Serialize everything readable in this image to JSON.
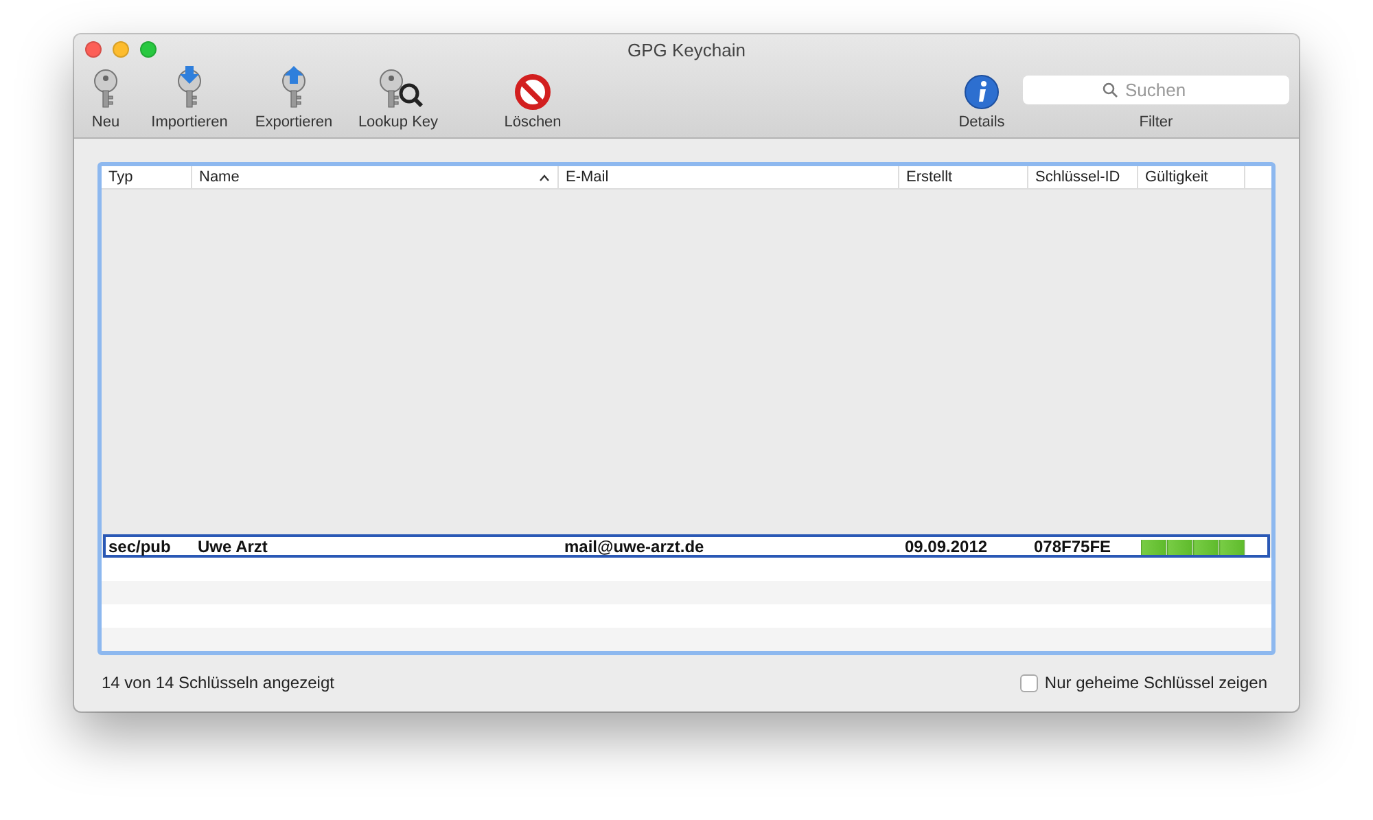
{
  "window": {
    "title": "GPG Keychain"
  },
  "toolbar": {
    "left": [
      {
        "kind": "new",
        "label": "Neu"
      },
      {
        "kind": "import",
        "label": "Importieren"
      },
      {
        "kind": "export",
        "label": "Exportieren"
      },
      {
        "kind": "lookup",
        "label": "Lookup Key"
      },
      {
        "kind": "delete",
        "label": "Löschen"
      }
    ],
    "details": {
      "label": "Details"
    },
    "filter": {
      "placeholder": "Suchen",
      "label": "Filter"
    }
  },
  "table": {
    "columns": [
      {
        "label": "Typ",
        "sorted": false
      },
      {
        "label": "Name",
        "sorted": true
      },
      {
        "label": "E-Mail",
        "sorted": false
      },
      {
        "label": "Erstellt",
        "sorted": false
      },
      {
        "label": "Schlüssel-ID",
        "sorted": false
      },
      {
        "label": "Gültigkeit",
        "sorted": false
      }
    ],
    "rows": [
      {
        "type": "sec/pub",
        "name": "Uwe Arzt",
        "email": "mail@uwe-arzt.de",
        "created": "09.09.2012",
        "key_id": "078F75FE",
        "validity": {
          "level": 1
        },
        "selected": true
      }
    ]
  },
  "status_bar": {
    "count": "14 von 14 Schlüsseln angezeigt",
    "secret_only": {
      "label": "Nur geheime Schlüssel zeigen",
      "checked": false
    }
  }
}
